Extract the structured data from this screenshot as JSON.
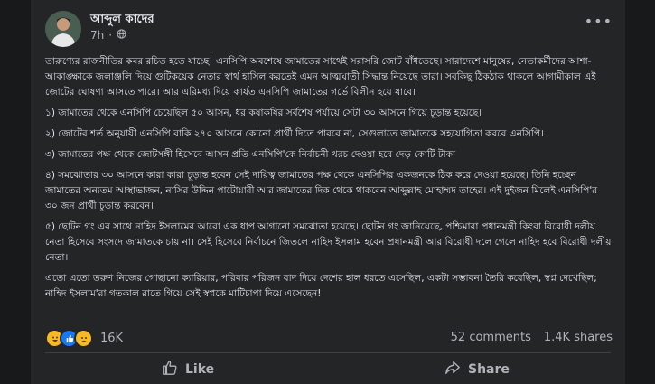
{
  "post": {
    "author": "আব্দুল কাদের",
    "time": "7h",
    "time_separator": "·",
    "paragraphs": [
      "তারুণ্যের রাজনীতির কবর রচিত হতে যাচ্ছে! এনসিপি অবশেষে জামাতের সাথেই সরাসরি জোট বাঁধতেছে। সারাদেশে মানুষের, নেতাকর্মীদের আশা-আকাঙ্ক্ষাকে জলাঞ্জলি দিয়ে গুটিকয়েক নেতার স্বার্থ হাসিল করতেই এমন আত্মঘাতী সিদ্ধান্ত নিয়েছে তারা। সবকিছু ঠিকঠাক থাকলে আগামীকাল এই জোটের ঘোষণা আসতে পারে। আর এরিমধ্য দিয়ে কার্যত এনসিপি জামাতের গর্ভে বিলীন হয়ে যাবে।",
      "১) জামাতের থেকে এনসিপি চেয়েছিল ৫০ আসন, ধর কষাকষির সর্বশেষ পর্যায়ে সেটা ৩০ আসনে গিয়ে চূড়ান্ত হয়েছে।",
      "২) জোটের শর্ত অনুযায়ী এনসিপি বাকি ২৭০ আসনে কোনো প্রার্থী দিতে পারবে না, সেগুলাতে জামাতকে সহযোগিতা করবে এনসিপি।",
      "৩) জামাতের পক্ষ থেকে জোটসঙ্গী হিসেবে আসন প্রতি এনসিপি'কে নির্বাচনী খরচ দেওয়া হবে দেড় কোটি টাকা",
      "৪) সমঝোতার ৩০ আসনে কারা কারা চূড়ান্ত হবেন সেই দায়িত্ব জামাতের পক্ষ থেকে এনসিপির একজনকে ঠিক করে দেওয়া হয়েছে। তিনি হচ্ছেন জামাতের অন্যতম আস্থাভাজন, নাসির উদ্দিন পাটোয়ারী আর জামাতের দিক থেকে থাকবেন আব্দুল্লাহ মোহাম্মদ তাহের। এই দুইজন মিলেই এনসিপি'র ৩০ জন প্রার্থী চূড়ান্ত করবেন।",
      "৫) ছোটন গং এর সাথে নাহিদ ইসলামের আরো এক ধাপ আগানো সমঝোতা হয়েছে। ছোটন গং জানিয়েছে, পশ্চিমারা প্রধানমন্ত্রী কিংবা বিরোধী দলীয় নেতা হিসেবে সংসদে জামাতকে চায় না। সেই হিসেবে নির্বাচনে জিতলে নাহিদ ইসলাম হবেন প্রধানমন্ত্রী আর বিরোধী দলে গেলে নাহিদ হবে বিরোধী দলীয় নেতা।",
      "এতো এতো তরুণ নিজের গোছানো ক্যারিয়ার, পরিবার পরিজন বাদ দিয়ে দেশের হাল ধরতে এসেছিল, একটা সম্ভাবনা তৈরি করেছিল, স্বপ্ন দেখেছিল; নাহিদ ইসলাম'রা গতকাল রাতে গিয়ে সেই স্বপ্নকে মাটিচাপা দিয়ে এসেছেন!"
    ]
  },
  "reactions": {
    "emojis": [
      "haha-icon",
      "like-icon",
      "sad-icon"
    ],
    "count": "16K",
    "comments": "52 comments",
    "shares": "1.4K shares"
  },
  "actions": {
    "like_label": "Like",
    "share_label": "Share"
  },
  "colors": {
    "background": "#18191a",
    "card": "#242526",
    "text": "#e4e6eb",
    "muted": "#b0b3b8",
    "like_blue": "#1877f2",
    "emoji_yellow": "#f7b928"
  }
}
